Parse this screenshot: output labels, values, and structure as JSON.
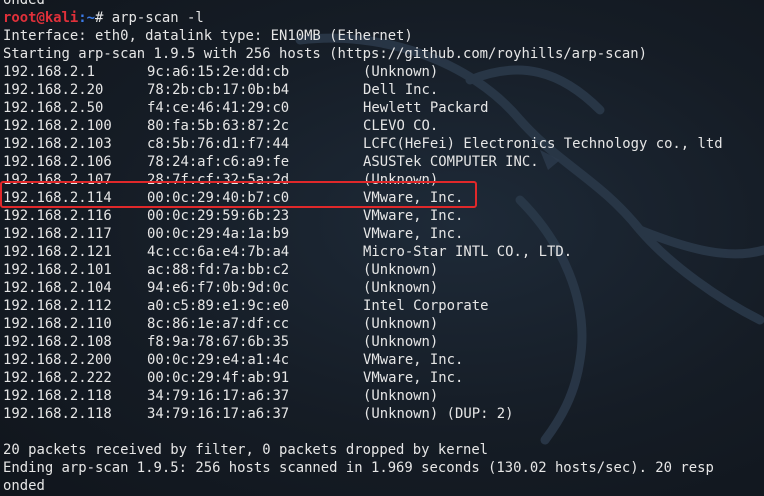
{
  "terminal": {
    "top_fragment": "onded",
    "prompt": {
      "user_host": "root@kali",
      "path": ":~",
      "symbol": "# ",
      "command": "arp-scan -l"
    },
    "interface_line": "Interface: eth0, datalink type: EN10MB (Ethernet)",
    "start_line": "Starting arp-scan 1.9.5 with 256 hosts (https://github.com/royhills/arp-scan)",
    "hosts": [
      {
        "ip": "192.168.2.1",
        "mac": "9c:a6:15:2e:dd:cb",
        "vendor": "(Unknown)"
      },
      {
        "ip": "192.168.2.20",
        "mac": "78:2b:cb:17:0b:b4",
        "vendor": "Dell Inc."
      },
      {
        "ip": "192.168.2.50",
        "mac": "f4:ce:46:41:29:c0",
        "vendor": "Hewlett Packard"
      },
      {
        "ip": "192.168.2.100",
        "mac": "80:fa:5b:63:87:2c",
        "vendor": "CLEVO CO."
      },
      {
        "ip": "192.168.2.103",
        "mac": "c8:5b:76:d1:f7:44",
        "vendor": "LCFC(HeFei) Electronics Technology co., ltd"
      },
      {
        "ip": "192.168.2.106",
        "mac": "78:24:af:c6:a9:fe",
        "vendor": "ASUSTek COMPUTER INC."
      },
      {
        "ip": "192.168.2.107",
        "mac": "28:7f:cf:32:5a:2d",
        "vendor": "(Unknown)"
      },
      {
        "ip": "192.168.2.114",
        "mac": "00:0c:29:40:b7:c0",
        "vendor": "VMware, Inc."
      },
      {
        "ip": "192.168.2.116",
        "mac": "00:0c:29:59:6b:23",
        "vendor": "VMware, Inc."
      },
      {
        "ip": "192.168.2.117",
        "mac": "00:0c:29:4a:1a:b9",
        "vendor": "VMware, Inc."
      },
      {
        "ip": "192.168.2.121",
        "mac": "4c:cc:6a:e4:7b:a4",
        "vendor": "Micro-Star INTL CO., LTD."
      },
      {
        "ip": "192.168.2.101",
        "mac": "ac:88:fd:7a:bb:c2",
        "vendor": "(Unknown)"
      },
      {
        "ip": "192.168.2.104",
        "mac": "94:e6:f7:0b:9d:0c",
        "vendor": "(Unknown)"
      },
      {
        "ip": "192.168.2.112",
        "mac": "a0:c5:89:e1:9c:e0",
        "vendor": "Intel Corporate"
      },
      {
        "ip": "192.168.2.110",
        "mac": "8c:86:1e:a7:df:cc",
        "vendor": "(Unknown)"
      },
      {
        "ip": "192.168.2.108",
        "mac": "f8:9a:78:67:6b:35",
        "vendor": "(Unknown)"
      },
      {
        "ip": "192.168.2.200",
        "mac": "00:0c:29:e4:a1:4c",
        "vendor": "VMware, Inc."
      },
      {
        "ip": "192.168.2.222",
        "mac": "00:0c:29:4f:ab:91",
        "vendor": "VMware, Inc."
      },
      {
        "ip": "192.168.2.118",
        "mac": "34:79:16:17:a6:37",
        "vendor": "(Unknown)"
      },
      {
        "ip": "192.168.2.118",
        "mac": "34:79:16:17:a6:37",
        "vendor": "(Unknown) (DUP: 2)"
      }
    ],
    "highlighted_host_ip": "192.168.2.114",
    "highlight_color": "#e0282a",
    "packets_line": "20 packets received by filter, 0 packets dropped by kernel",
    "ending_line": "Ending arp-scan 1.9.5: 256 hosts scanned in 1.969 seconds (130.02 hosts/sec). 20 resp",
    "ending_continuation": "onded",
    "colors": {
      "background": "#151c25",
      "text": "#e6e6e6",
      "prompt_user": "#e0303a",
      "prompt_path": "#3b7be8"
    },
    "background_icon": "kali-dragon-watermark"
  }
}
